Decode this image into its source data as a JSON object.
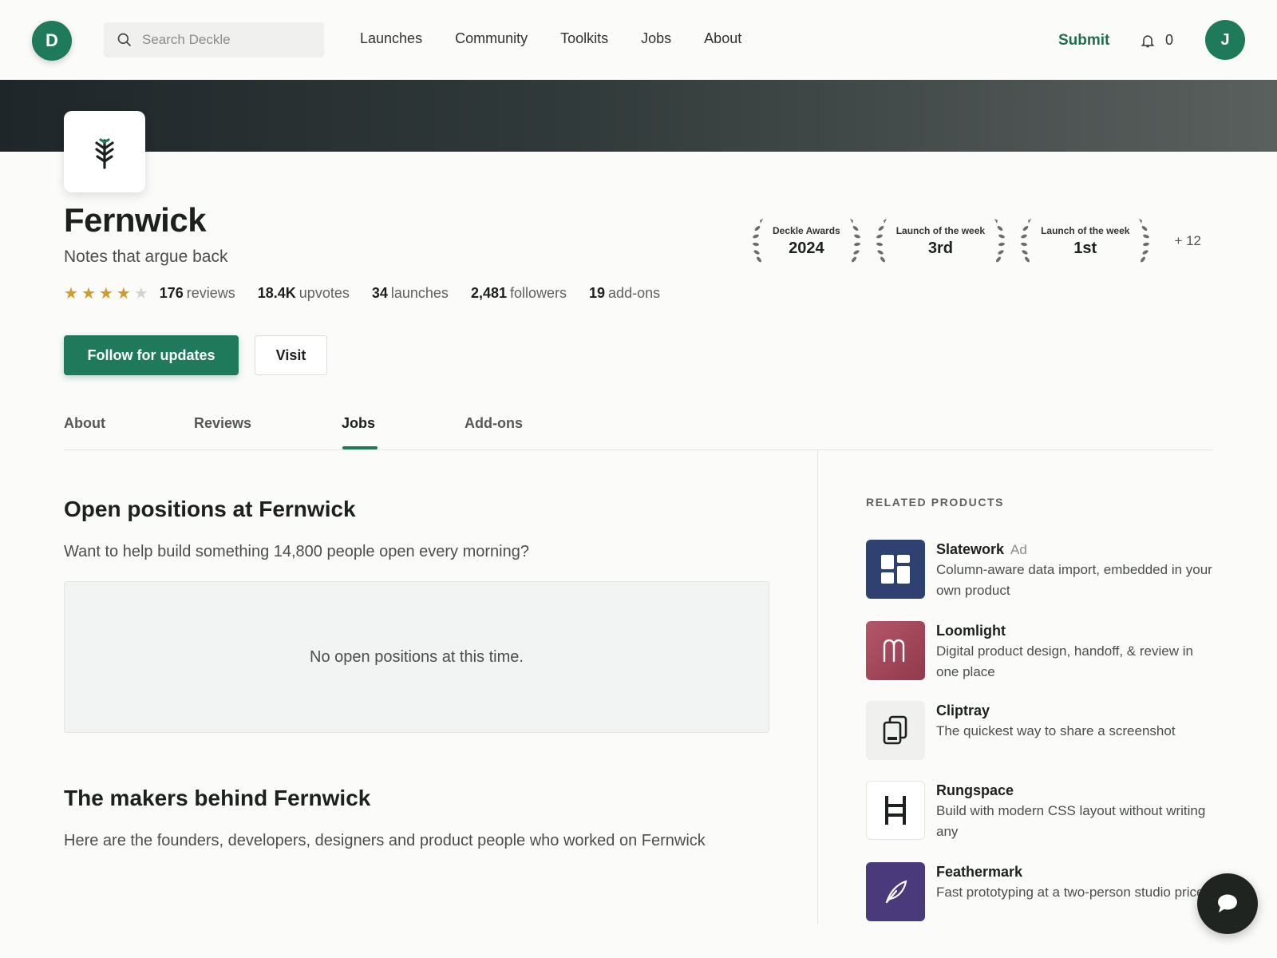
{
  "brand": {
    "initial": "D"
  },
  "search": {
    "placeholder": "Search Deckle"
  },
  "nav": {
    "items": [
      "Launches",
      "Community",
      "Toolkits",
      "Jobs",
      "About"
    ]
  },
  "header": {
    "submit_label": "Submit",
    "notification_count": "0",
    "user_initial": "J"
  },
  "product": {
    "name": "Fernwick",
    "tagline": "Notes that argue back",
    "rating": 4,
    "rating_max": 5,
    "stats": [
      {
        "value": "176",
        "label": "reviews"
      },
      {
        "value": "18.4K",
        "label": "upvotes"
      },
      {
        "value": "34",
        "label": "launches"
      },
      {
        "value": "2,481",
        "label": "followers"
      },
      {
        "value": "19",
        "label": "add-ons"
      }
    ]
  },
  "awards": {
    "items": [
      {
        "title": "Deckle Awards",
        "value": "2024"
      },
      {
        "title": "Launch of the week",
        "value": "3rd"
      },
      {
        "title": "Launch of the week",
        "value": "1st"
      }
    ],
    "more": "+ 12"
  },
  "actions": {
    "follow_label": "Follow for updates",
    "visit_label": "Visit"
  },
  "tabs": [
    {
      "label": "About",
      "active": false
    },
    {
      "label": "Reviews",
      "active": false
    },
    {
      "label": "Jobs",
      "active": true
    },
    {
      "label": "Add-ons",
      "active": false
    }
  ],
  "jobs": {
    "heading": "Open positions at Fernwick",
    "intro": "Want to help build something 14,800 people open every morning?",
    "empty": "No open positions at this time."
  },
  "makers": {
    "heading": "The makers behind Fernwick",
    "intro": "Here are the founders, developers, designers and product people who worked on Fernwick"
  },
  "related": {
    "heading": "RELATED PRODUCTS",
    "items": [
      {
        "name": "Slatework",
        "ad": "Ad",
        "desc": "Column-aware data import, embedded in your own product",
        "icon": "dashboard-tiles-icon",
        "color": "#2f4170"
      },
      {
        "name": "Loomlight",
        "ad": "",
        "desc": "Digital product design, handoff, & review in one place",
        "icon": "letter-m-icon",
        "color": "#a8475a"
      },
      {
        "name": "Cliptray",
        "ad": "",
        "desc": "The quickest way to share a screenshot",
        "icon": "stacked-screens-icon",
        "color": "#f0f0ee"
      },
      {
        "name": "Rungspace",
        "ad": "",
        "desc": "Build with modern CSS layout without writing any",
        "icon": "ladder-h-icon",
        "color": "#ffffff"
      },
      {
        "name": "Feathermark",
        "ad": "",
        "desc": "Fast prototyping at a two-person studio price",
        "icon": "feather-icon",
        "color": "#4a3a7c"
      }
    ]
  },
  "colors": {
    "accent": "#1e7a5a",
    "star": "#d19a2a"
  }
}
